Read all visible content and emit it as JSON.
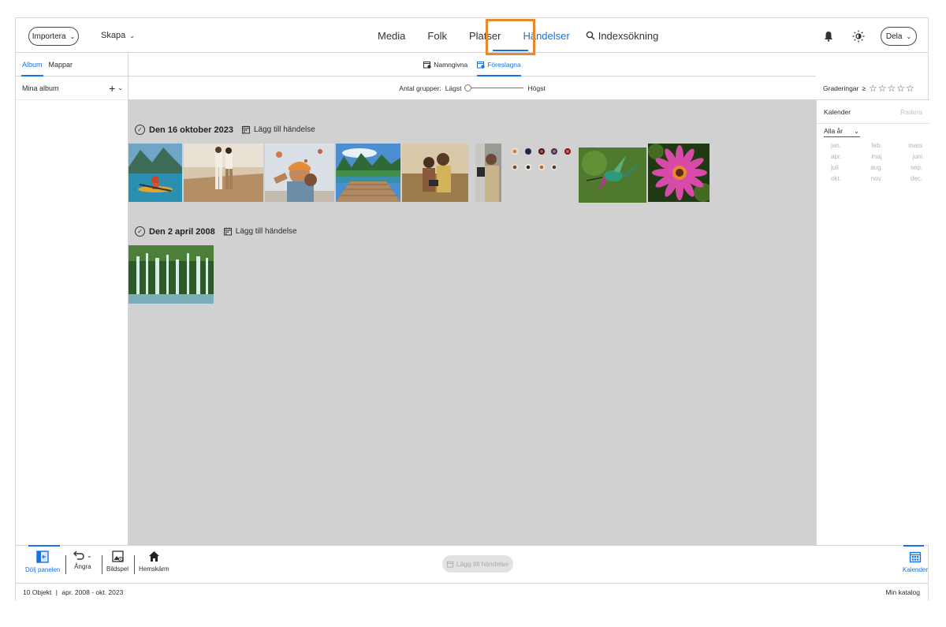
{
  "topbar": {
    "import_label": "Importera",
    "create_label": "Skapa",
    "share_label": "Dela",
    "nav": [
      "Media",
      "Folk",
      "Platser",
      "Händelser"
    ],
    "search_label": "Indexsökning"
  },
  "sidebar": {
    "tabs": [
      "Album",
      "Mappar"
    ],
    "my_albums": "Mina album"
  },
  "subnav": {
    "named": "Namngivna",
    "suggested": "Föreslagna"
  },
  "filter": {
    "label": "Antal grupper:",
    "low": "Lägst",
    "high": "Högst"
  },
  "ratings": {
    "label": "Graderingar",
    "op": "≥",
    "stars": "☆☆☆☆☆"
  },
  "calendar_panel": {
    "title": "Kalender",
    "clear": "Radera",
    "year": "Alla år",
    "months": [
      "jan.",
      "feb.",
      "mars",
      "apr.",
      "maj",
      "juni",
      "juli",
      "aug.",
      "sep.",
      "okt.",
      "nov.",
      "dec."
    ]
  },
  "events": [
    {
      "title": "Den 16 oktober 2023",
      "add_label": "Lägg till händelse"
    },
    {
      "title": "Den 2 april 2008",
      "add_label": "Lägg till händelse"
    }
  ],
  "toolbar": {
    "hide_panel": "Dölj panelen",
    "undo": "Ångra",
    "slideshow": "Bildspel",
    "home": "Hemskärm",
    "add_event": "Lägg till händelse",
    "calendar": "Kalender"
  },
  "status": {
    "count": "10 Objekt",
    "range": "apr. 2008 - okt. 2023",
    "catalog": "Min katalog"
  },
  "colors": {
    "accent": "#1473e6",
    "highlight": "#e8892e",
    "grid_bg": "#d1d1d1"
  }
}
